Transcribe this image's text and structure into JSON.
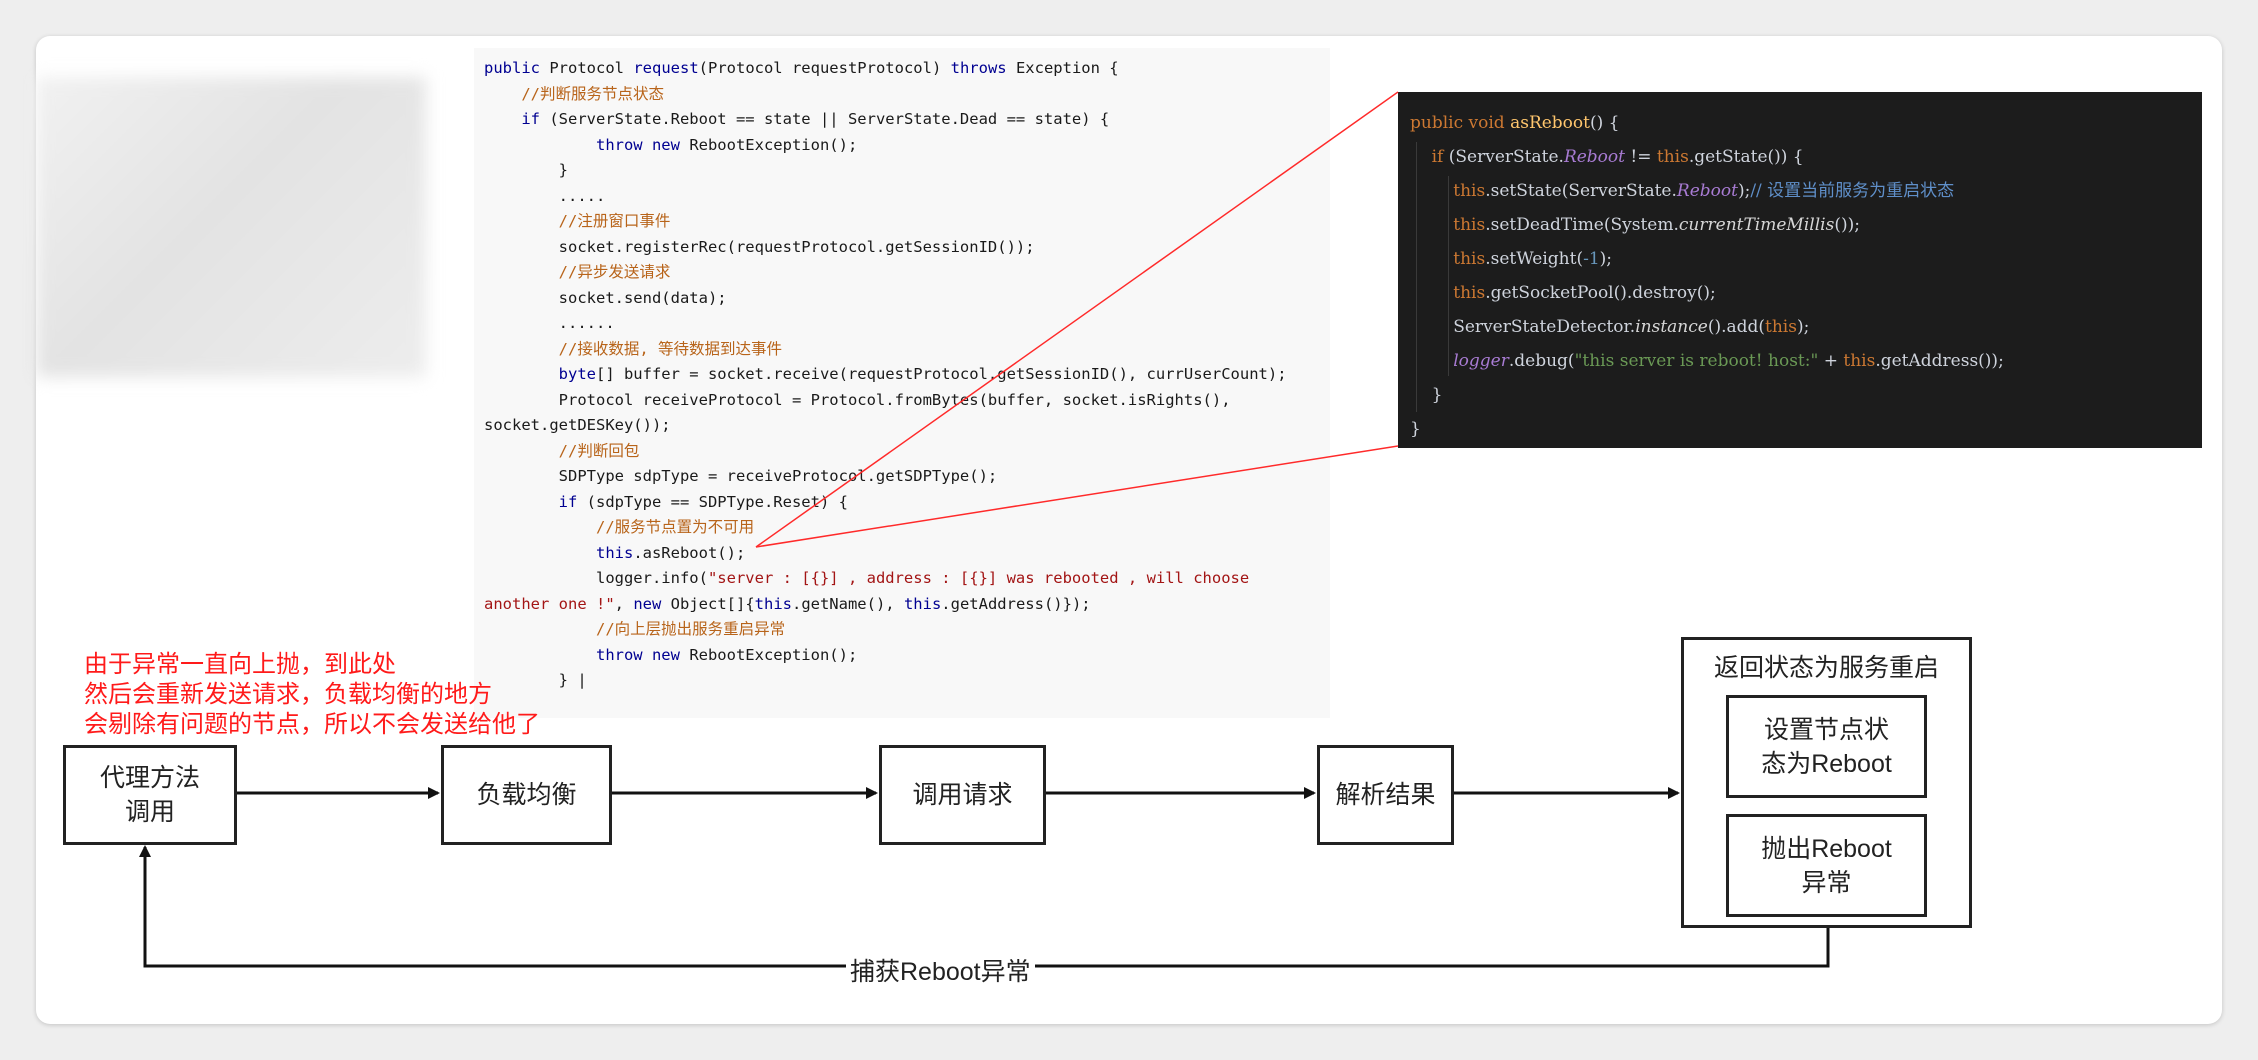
{
  "code_left": {
    "lines": [
      [
        [
          "kw",
          "public"
        ],
        [
          "t",
          " Protocol "
        ],
        [
          "kw",
          "request"
        ],
        [
          "t",
          "(Protocol requestProtocol) "
        ],
        [
          "kw",
          "throws"
        ],
        [
          "t",
          " Exception {"
        ]
      ],
      [
        [
          "t",
          "    "
        ],
        [
          "cm",
          "//判断服务节点状态"
        ]
      ],
      [
        [
          "t",
          "    "
        ],
        [
          "kw",
          "if"
        ],
        [
          "t",
          " (ServerState.Reboot == state || ServerState.Dead == state) {"
        ]
      ],
      [
        [
          "t",
          "            "
        ],
        [
          "kw",
          "throw new"
        ],
        [
          "t",
          " RebootException();"
        ]
      ],
      [
        [
          "t",
          "        }"
        ]
      ],
      [
        [
          "t",
          "        ....."
        ]
      ],
      [
        [
          "t",
          "        "
        ],
        [
          "cm",
          "//注册窗口事件"
        ]
      ],
      [
        [
          "t",
          "        socket.registerRec(requestProtocol.getSessionID());"
        ]
      ],
      [
        [
          "t",
          "        "
        ],
        [
          "cm",
          "//异步发送请求"
        ]
      ],
      [
        [
          "t",
          "        socket.send(data);"
        ]
      ],
      [
        [
          "t",
          "        ......"
        ]
      ],
      [
        [
          "t",
          "        "
        ],
        [
          "cm",
          "//接收数据, 等待数据到达事件"
        ]
      ],
      [
        [
          "t",
          "        "
        ],
        [
          "kw",
          "byte"
        ],
        [
          "t",
          "[] buffer = socket.receive(requestProtocol.getSessionID(), currUserCount);"
        ]
      ],
      [
        [
          "t",
          "        Protocol receiveProtocol = Protocol.fromBytes(buffer, socket.isRights(),"
        ]
      ],
      [
        [
          "t",
          "socket.getDESKey());"
        ]
      ],
      [
        [
          "t",
          "        "
        ],
        [
          "cm",
          "//判断回包"
        ]
      ],
      [
        [
          "t",
          "        SDPType sdpType = receiveProtocol.getSDPType();"
        ]
      ],
      [
        [
          "t",
          "        "
        ],
        [
          "kw",
          "if"
        ],
        [
          "t",
          " (sdpType == SDPType.Reset) {"
        ]
      ],
      [
        [
          "t",
          "            "
        ],
        [
          "cm",
          "//服务节点置为不可用"
        ]
      ],
      [
        [
          "t",
          "            "
        ],
        [
          "kw",
          "this"
        ],
        [
          "t",
          ".asReboot();"
        ]
      ],
      [
        [
          "t",
          "            logger.info("
        ],
        [
          "st",
          "\"server : [{}] , address : [{}] was rebooted , will choose"
        ]
      ],
      [
        [
          "st",
          "another one !\""
        ],
        [
          "t",
          ", "
        ],
        [
          "kw",
          "new"
        ],
        [
          "t",
          " Object[]{"
        ],
        [
          "kw",
          "this"
        ],
        [
          "t",
          ".getName(), "
        ],
        [
          "kw",
          "this"
        ],
        [
          "t",
          ".getAddress()});"
        ]
      ],
      [
        [
          "t",
          "            "
        ],
        [
          "cm",
          "//向上层抛出服务重启异常"
        ]
      ],
      [
        [
          "t",
          "            "
        ],
        [
          "kw",
          "throw new"
        ],
        [
          "t",
          " RebootException();"
        ]
      ],
      [
        [
          "t",
          "        } |"
        ]
      ]
    ]
  },
  "code_right": {
    "lines": [
      [
        [
          "k2",
          "public void "
        ],
        [
          "f2",
          "asReboot"
        ],
        [
          "t",
          "() {"
        ]
      ],
      [
        [
          "t",
          "    "
        ],
        [
          "k2",
          "if"
        ],
        [
          "t",
          " (ServerState."
        ],
        [
          "p2",
          "Reboot"
        ],
        [
          "t",
          " != "
        ],
        [
          "k2",
          "this"
        ],
        [
          "t",
          ".getState()) {"
        ]
      ],
      [
        [
          "t",
          "        "
        ],
        [
          "k2",
          "this"
        ],
        [
          "t",
          ".setState(ServerState."
        ],
        [
          "p2",
          "Reboot"
        ],
        [
          "t",
          ");"
        ],
        [
          "c2",
          "// 设置当前服务为重启状态"
        ]
      ],
      [
        [
          "t",
          "        "
        ],
        [
          "k2",
          "this"
        ],
        [
          "t",
          ".setDeadTime(System."
        ],
        [
          "i2",
          "currentTimeMillis"
        ],
        [
          "t",
          "());"
        ]
      ],
      [
        [
          "t",
          "        "
        ],
        [
          "k2",
          "this"
        ],
        [
          "t",
          ".setWeight("
        ],
        [
          "n2",
          "-1"
        ],
        [
          "t",
          ");"
        ]
      ],
      [
        [
          "t",
          "        "
        ],
        [
          "k2",
          "this"
        ],
        [
          "t",
          ".getSocketPool().destroy();"
        ]
      ],
      [
        [
          "t",
          "        ServerStateDetector."
        ],
        [
          "i2",
          "instance"
        ],
        [
          "t",
          "().add("
        ],
        [
          "k2",
          "this"
        ],
        [
          "t",
          ");"
        ]
      ],
      [
        [
          "t",
          "        "
        ],
        [
          "p2",
          "logger"
        ],
        [
          "t",
          ".debug("
        ],
        [
          "g2",
          "\"this server is reboot! host:\""
        ],
        [
          "t",
          " + "
        ],
        [
          "k2",
          "this"
        ],
        [
          "t",
          ".getAddress());"
        ]
      ],
      [
        [
          "t",
          "    }"
        ]
      ],
      [
        [
          "t",
          "}"
        ]
      ]
    ]
  },
  "note": {
    "line1": "由于异常一直向上抛，到此处",
    "line2": "然后会重新发送请求，负载均衡的地方",
    "line3": "会剔除有问题的节点，所以不会发送给他了"
  },
  "flow": {
    "proxy_line1": "代理方法",
    "proxy_line2": "调用",
    "load_balance": "负载均衡",
    "invoke": "调用请求",
    "parse": "解析结果",
    "return_title": "返回状态为服务重启",
    "set_state_line1": "设置节点状",
    "set_state_line2": "态为Reboot",
    "throw_line1": "抛出Reboot",
    "throw_line2": "异常",
    "catch_label": "捕获Reboot异常"
  },
  "colors": {
    "note": "#ff1a1a",
    "callout_line": "#ff2a2a",
    "dark_code_bg": "#1c1c1c"
  }
}
